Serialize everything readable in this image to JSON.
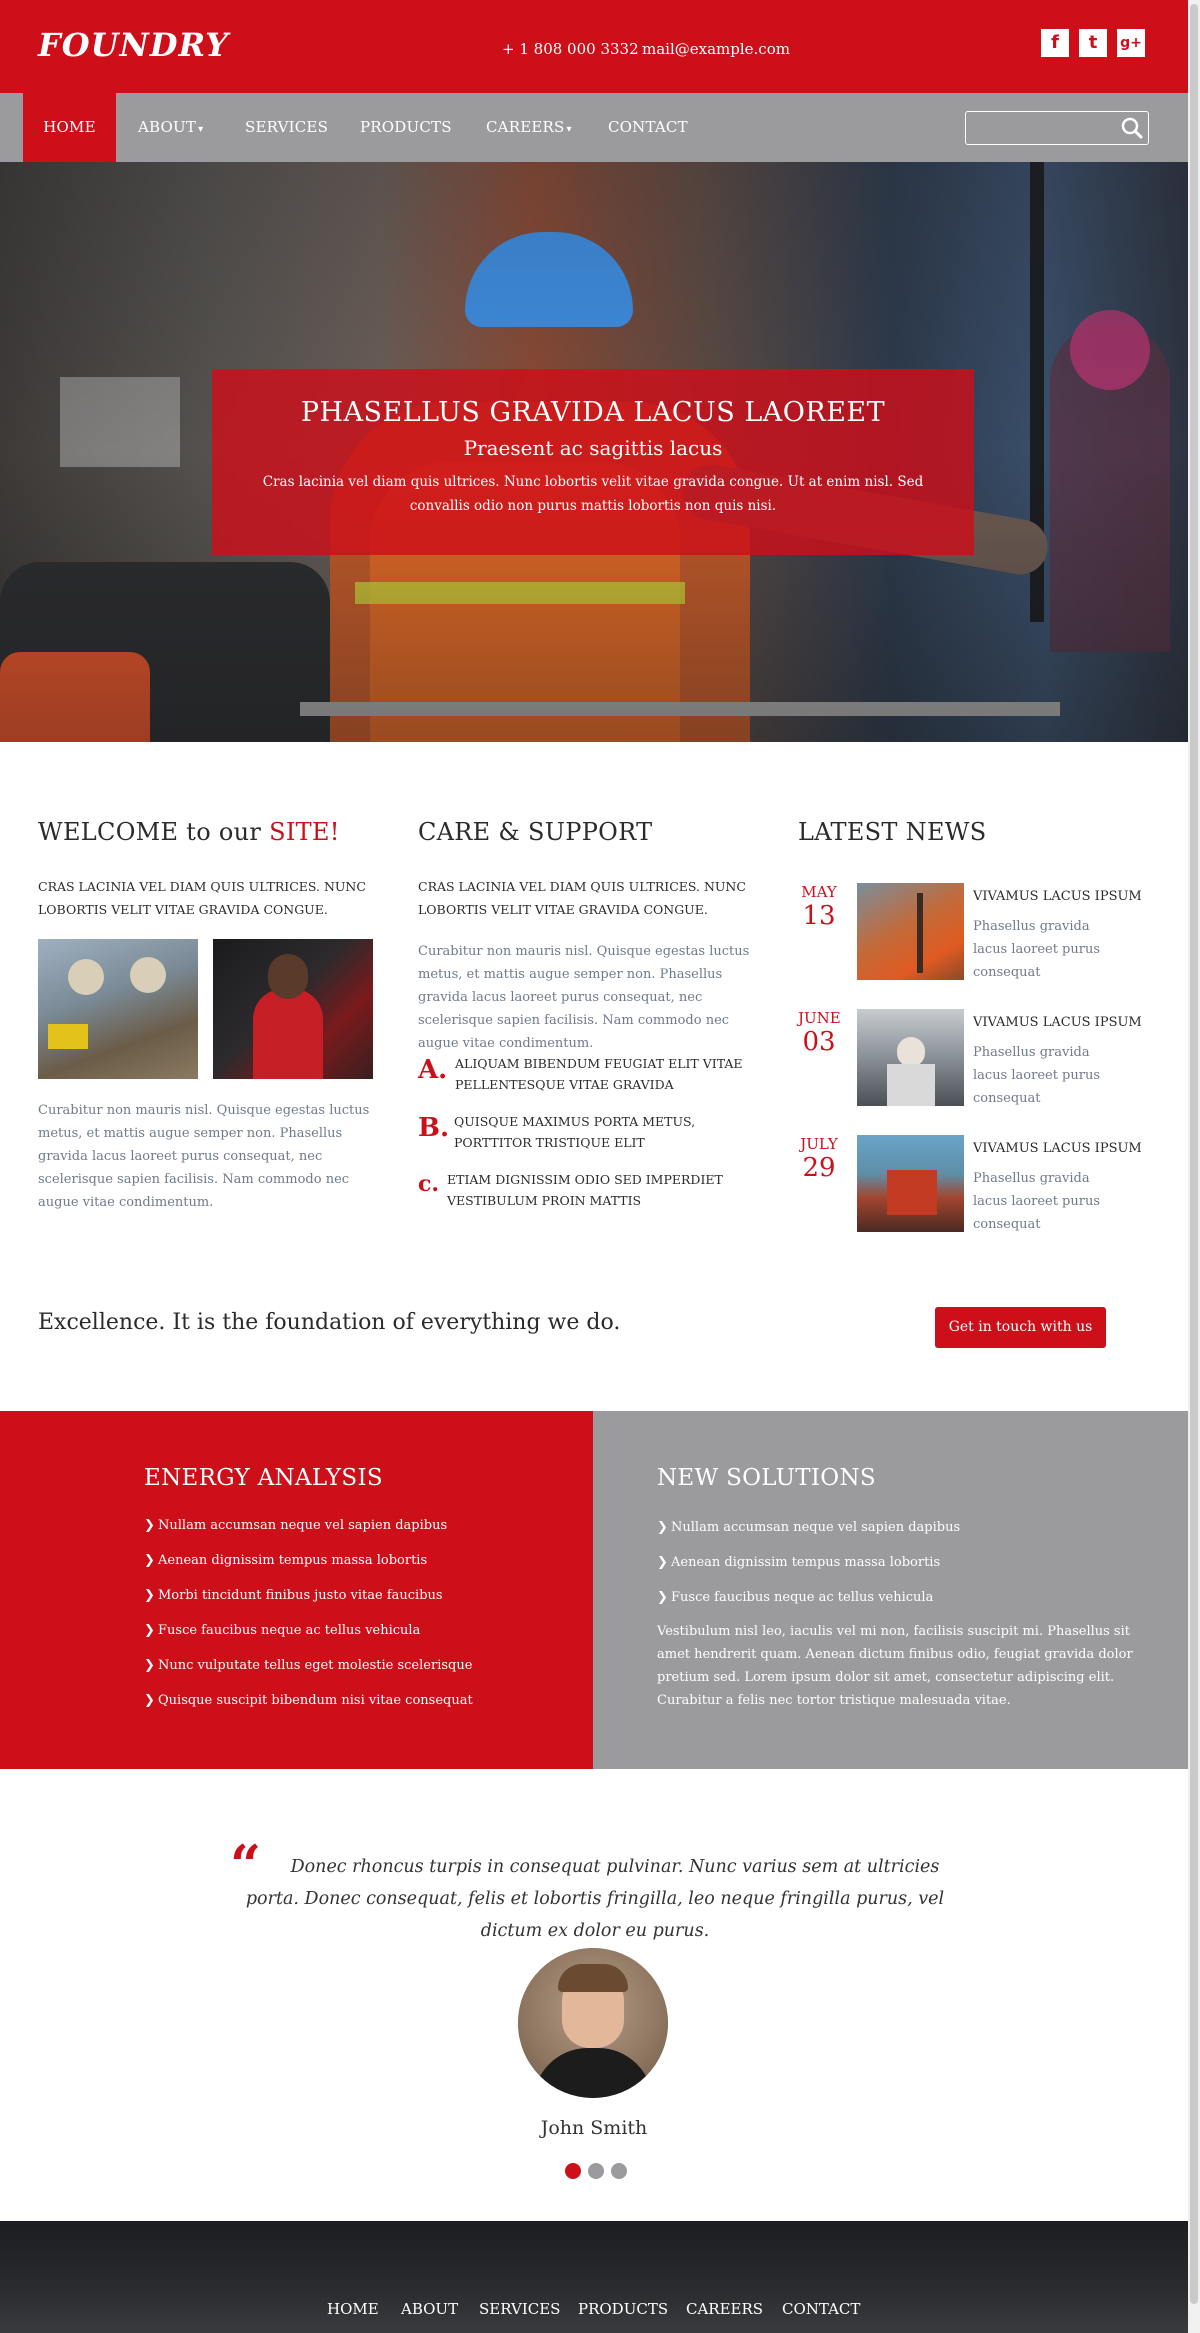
{
  "header": {
    "logo": "FOUNDRY",
    "phone": "+ 1 808 000 3332",
    "email": "mail@example.com",
    "social_icons": [
      "facebook-icon",
      "twitter-icon",
      "google-plus-icon"
    ],
    "social_glyphs": [
      "f",
      "t",
      "g+"
    ]
  },
  "nav": {
    "items": [
      {
        "label": "HOME",
        "active": true,
        "dropdown": false
      },
      {
        "label": "ABOUT",
        "active": false,
        "dropdown": true
      },
      {
        "label": "SERVICES",
        "active": false,
        "dropdown": false
      },
      {
        "label": "PRODUCTS",
        "active": false,
        "dropdown": false
      },
      {
        "label": "CAREERS",
        "active": false,
        "dropdown": true
      },
      {
        "label": "CONTACT",
        "active": false,
        "dropdown": false
      }
    ],
    "search_placeholder": ""
  },
  "hero": {
    "title": "PHASELLUS GRAVIDA LACUS LAOREET",
    "subtitle": "Praesent ac sagittis lacus",
    "text": "Cras lacinia vel diam quis ultrices. Nunc lobortis velit vitae gravida congue. Ut at enim nisl. Sed convallis odio non purus mattis lobortis non quis nisi."
  },
  "welcome": {
    "title_prefix": "WELCOME to our ",
    "title_highlight": "SITE!",
    "lead": "CRAS LACINIA VEL DIAM QUIS ULTRICES. NUNC LOBORTIS VELIT VITAE GRAVIDA CONGUE.",
    "text": "Curabitur non mauris nisl. Quisque egestas luctus metus, et mattis augue semper non. Phasellus gravida lacus laoreet purus consequat, nec scelerisque sapien facilisis. Nam commodo nec augue vitae condimentum."
  },
  "care": {
    "title": "CARE & SUPPORT",
    "lead": "CRAS LACINIA VEL DIAM QUIS ULTRICES. NUNC LOBORTIS VELIT VITAE GRAVIDA CONGUE.",
    "text": "Curabitur non mauris nisl. Quisque egestas luctus metus, et mattis augue semper non. Phasellus gravida lacus laoreet purus consequat, nec scelerisque sapien facilisis. Nam commodo nec augue vitae condimentum.",
    "items": [
      {
        "letter": "A.",
        "text": "ALIQUAM BIBENDUM FEUGIAT ELIT VITAE PELLENTESQUE VITAE GRAVIDA"
      },
      {
        "letter": "B.",
        "text": "QUISQUE MAXIMUS PORTA METUS, PORTTITOR TRISTIQUE ELIT"
      },
      {
        "letter": "c.",
        "text": "ETIAM DIGNISSIM ODIO SED IMPERDIET VESTIBULUM PROIN MATTIS"
      }
    ]
  },
  "news": {
    "title": "LATEST NEWS",
    "items": [
      {
        "month": "MAY",
        "day": "13",
        "title": "VIVAMUS LACUS IPSUM",
        "text": "Phasellus gravida lacus laoreet purus consequat"
      },
      {
        "month": "JUNE",
        "day": "03",
        "title": "VIVAMUS LACUS IPSUM",
        "text": "Phasellus gravida lacus laoreet purus consequat"
      },
      {
        "month": "JULY",
        "day": "29",
        "title": "VIVAMUS LACUS IPSUM",
        "text": "Phasellus gravida lacus laoreet purus consequat"
      }
    ]
  },
  "cta": {
    "text": "Excellence. It is the foundation of everything we do.",
    "button": "Get in touch with us"
  },
  "energy": {
    "title": "ENERGY ANALYSIS",
    "items": [
      "Nullam accumsan neque vel sapien dapibus",
      "Aenean dignissim tempus massa lobortis",
      "Morbi tincidunt finibus justo vitae faucibus",
      "Fusce faucibus neque ac tellus vehicula",
      "Nunc vulputate tellus eget molestie scelerisque",
      "Quisque suscipit bibendum nisi vitae consequat"
    ]
  },
  "solutions": {
    "title": "NEW SOLUTIONS",
    "items": [
      "Nullam accumsan neque vel sapien dapibus",
      "Aenean dignissim tempus massa lobortis",
      "Fusce faucibus neque ac tellus vehicula"
    ],
    "text": "Vestibulum nisl leo, iaculis vel mi non, facilisis suscipit mi. Phasellus sit amet hendrerit quam. Aenean dictum finibus odio, feugiat gravida dolor pretium sed. Lorem ipsum dolor sit amet, consectetur adipiscing elit. Curabitur a felis nec tortor tristique malesuada vitae."
  },
  "testimonial": {
    "quote_mark": "“",
    "quote": "Donec rhoncus turpis in consequat pulvinar. Nunc varius sem at ultricies porta. Donec consequat, felis et lobortis fringilla, leo neque fringilla purus, vel dictum ex dolor eu purus.",
    "author": "John Smith",
    "slides": 3,
    "active_slide": 1
  },
  "footer": {
    "links": [
      "HOME",
      "ABOUT",
      "SERVICES",
      "PRODUCTS",
      "CAREERS",
      "CONTACT"
    ]
  },
  "colors": {
    "brand_red": "#cd0f1a",
    "nav_gray": "#9b9b9e",
    "muted_text": "#6f7a8a"
  }
}
